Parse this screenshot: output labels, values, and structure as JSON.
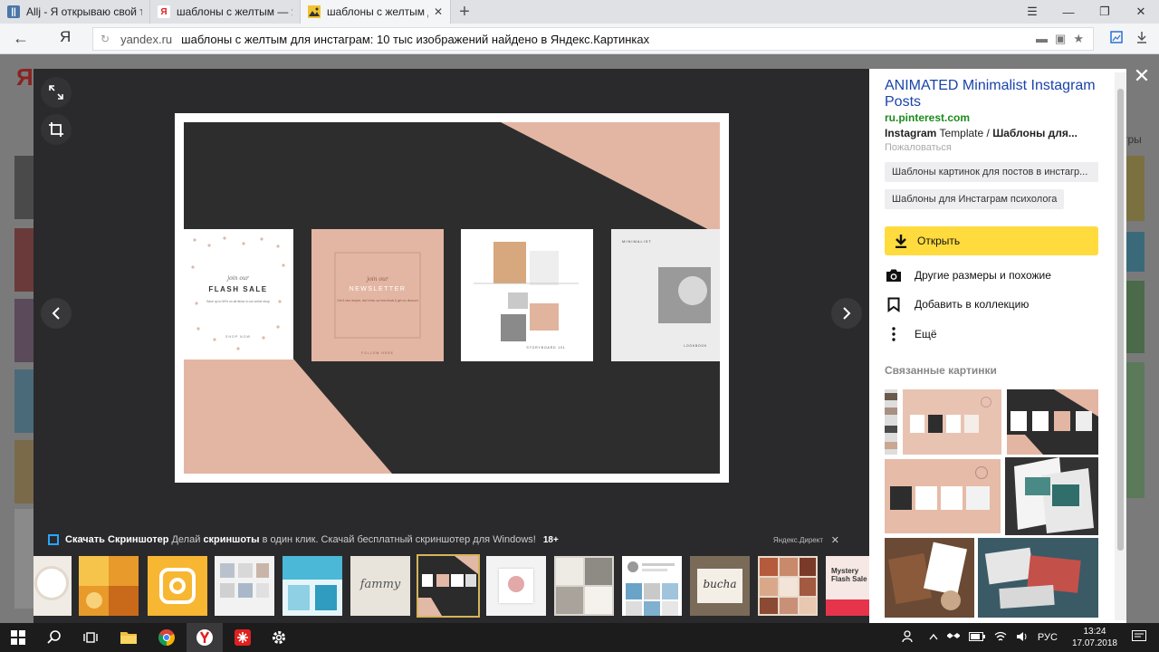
{
  "browser": {
    "tabs": [
      {
        "label": "Allj - Я открываю свой теле",
        "favicon": "vk",
        "active": false
      },
      {
        "label": "шаблоны с желтым — Янде",
        "favicon": "yandex",
        "active": false
      },
      {
        "label": "шаблоны с желтым для инс",
        "favicon": "images",
        "active": true
      }
    ],
    "new_tab": "+",
    "window_controls": {
      "menu": "☰",
      "minimize": "—",
      "restore": "❐",
      "close": "✕"
    },
    "back": "←",
    "yandex_button": "Я",
    "address": {
      "host": "yandex.ru",
      "page_title": "шаблоны с желтым для инстаграм: 10 тыс изображений найдено в Яндекс.Картинках"
    }
  },
  "page_behind": {
    "logo": "Ян",
    "right_text": "тры"
  },
  "viewer": {
    "prev": "‹",
    "next": "›",
    "main_image": {
      "cards": [
        {
          "top": "join our",
          "title": "FLASH SALE",
          "body": "Save up to 50% on all items in our online shop",
          "foot": "SHOP NOW"
        },
        {
          "top": "join our",
          "title": "NEWSLETTER",
          "body": "Get 5 new recipes, don't miss our best deals & get our discount",
          "foot": "FOLLOW HERE"
        },
        {
          "top": "",
          "title": "",
          "body": "",
          "foot": "STORYBOARD 101"
        },
        {
          "top": "MINIMALIST",
          "title": "",
          "body": "",
          "foot": "LOOKBOOK"
        }
      ]
    },
    "promo": {
      "title": "Скачать Скриншотер",
      "text_a": "Делай",
      "text_b": "скриншоты",
      "text_c": "в один клик. Скачай бесплатный скриншотер для Windows!",
      "age": "18+",
      "direct": "Яндекс.Директ",
      "close": "✕"
    },
    "thumbnails": [
      {
        "name": "coffee",
        "palette": [
          "#f0ebe4",
          "#d8cfc4"
        ]
      },
      {
        "name": "orange-collage",
        "palette": [
          "#e89a2a",
          "#f6c44a"
        ]
      },
      {
        "name": "instagram-logo",
        "palette": [
          "#f7b733",
          "#ffffff"
        ]
      },
      {
        "name": "white-grid",
        "palette": [
          "#f2f2f2",
          "#b9c2cc"
        ]
      },
      {
        "name": "blue-templates",
        "palette": [
          "#4ab8d6",
          "#e6f5fa"
        ]
      },
      {
        "name": "fammy",
        "palette": [
          "#e8e4dc",
          "#6b6b6b"
        ],
        "text": "fammy"
      },
      {
        "name": "selected-dark-pink",
        "palette": [
          "#2b2b2b",
          "#e2b8a6"
        ],
        "selected": true
      },
      {
        "name": "pink-cake",
        "palette": [
          "#f3f3f3",
          "#e3a8a8"
        ]
      },
      {
        "name": "photo-grid",
        "palette": [
          "#d9d5cf",
          "#8e8a84"
        ]
      },
      {
        "name": "profile-feed",
        "palette": [
          "#ffffff",
          "#6aa3c8"
        ]
      },
      {
        "name": "bucha",
        "palette": [
          "#7a6a58",
          "#f4efe6"
        ],
        "text": "bucha"
      },
      {
        "name": "brown-grid",
        "palette": [
          "#b55a3c",
          "#e8d8c8"
        ]
      },
      {
        "name": "mystery-flash",
        "palette": [
          "#f6e8e4",
          "#e6344a"
        ],
        "text": "Mystery Flash Sale"
      }
    ]
  },
  "panel": {
    "title": "ANIMATED Minimalist Instagram Posts",
    "host": "ru.pinterest.com",
    "path_a": "Instagram",
    "path_b": "Template /",
    "path_c": "Шаблоны для...",
    "complain": "Пожаловаться",
    "tags": [
      "Шаблоны картинок для постов в инстагр...",
      "Шаблоны для Инстаграм психолога"
    ],
    "open_button": "Открыть",
    "actions": [
      {
        "label": "Другие размеры и похожие",
        "icon": "camera-icon"
      },
      {
        "label": "Добавить в коллекцию",
        "icon": "bookmark-icon"
      },
      {
        "label": "Ещё",
        "icon": "more-icon"
      }
    ],
    "related_heading": "Связанные картинки",
    "close": "✕"
  },
  "taskbar": {
    "lang": "РУС",
    "time": "13:24",
    "date": "17.07.2018"
  },
  "colors": {
    "viewer_bg": "#2a2a2c",
    "panel_link": "#1a44aa",
    "host_green": "#1d8a1d",
    "open_yellow": "#ffdb3d",
    "pink": "#e3b6a3",
    "dark": "#2d2d2e"
  }
}
